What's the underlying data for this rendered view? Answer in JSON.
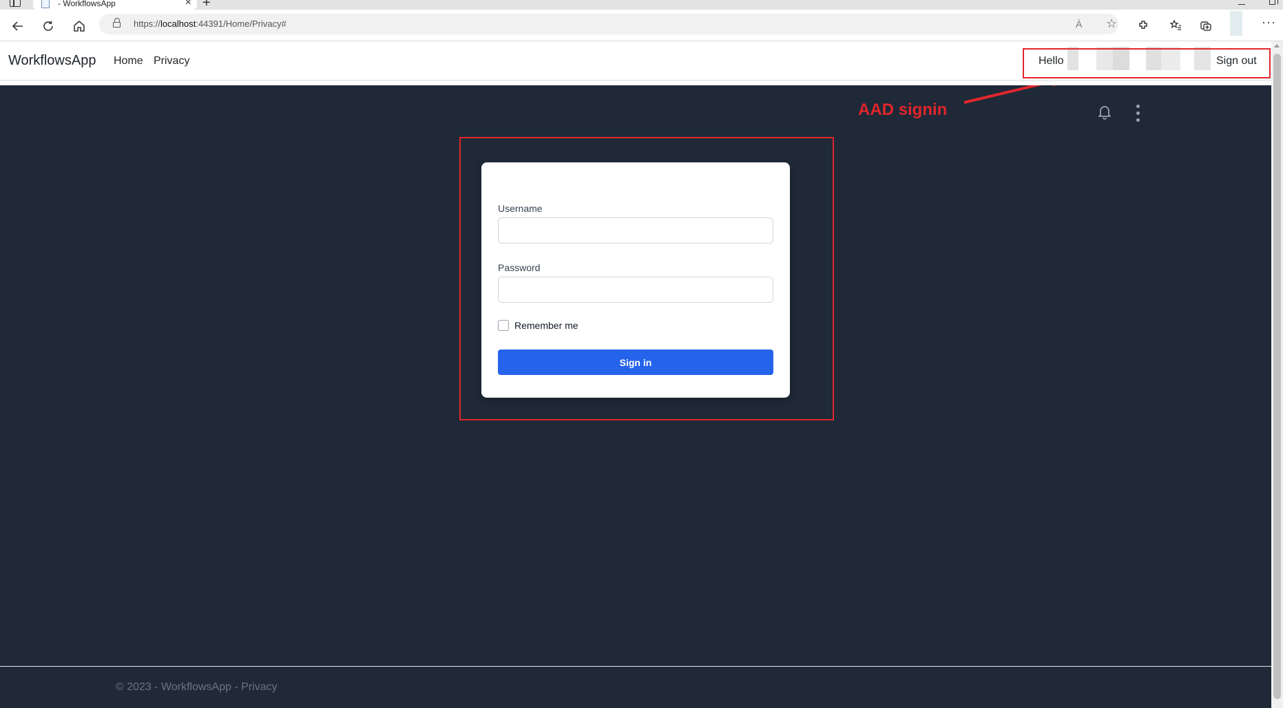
{
  "browser": {
    "tab_title": "- WorkflowsApp",
    "new_tab_symbol": "+",
    "close_symbol": "×",
    "url_scheme": "https://",
    "url_host": "localhost",
    "url_rest": ":44391/Home/Privacy#",
    "read_aloud": "À",
    "menu_symbol": "···"
  },
  "site": {
    "brand": "WorkflowsApp",
    "nav_items": [
      "Home",
      "Privacy"
    ],
    "hello": "Hello",
    "sign_out": "Sign out"
  },
  "annotation": {
    "label": "AAD signin",
    "color": "#e0262d"
  },
  "login": {
    "username_label": "Username",
    "username_value": "",
    "password_label": "Password",
    "password_value": "",
    "remember_label": "Remember me",
    "remember_checked": false,
    "submit_label": "Sign in",
    "accent": "#2563eb"
  },
  "footer": {
    "text": "© 2023 - WorkflowsApp - Privacy"
  },
  "icons": {
    "bell": "bell-icon",
    "kebab": "kebab-menu-icon"
  },
  "colors": {
    "page_background": "#1f2937",
    "card_background": "#ffffff"
  }
}
